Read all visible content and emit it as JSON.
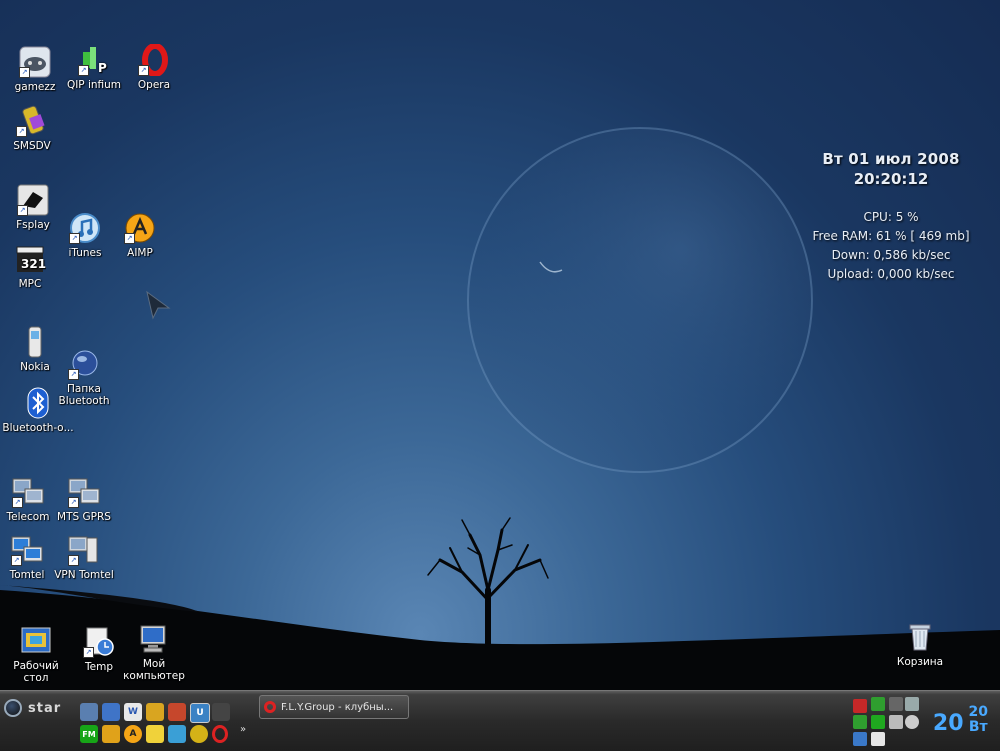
{
  "desktop": {
    "icons": [
      {
        "label": "gamezz",
        "icon": "gamepad-icon"
      },
      {
        "label": "QIP infium",
        "icon": "qip-flower-icon"
      },
      {
        "label": "Opera",
        "icon": "opera-icon"
      },
      {
        "label": "SMSDV",
        "icon": "phone-sms-icon"
      },
      {
        "label": "Fsplay",
        "icon": "fsplay-icon"
      },
      {
        "label": "iTunes",
        "icon": "itunes-icon"
      },
      {
        "label": "AIMP",
        "icon": "aimp-icon"
      },
      {
        "label": "MPC",
        "icon": "mpc-clapper-icon"
      },
      {
        "label": "Nokia",
        "icon": "nokia-phone-icon"
      },
      {
        "label": "Папка Bluetooth",
        "icon": "bluetooth-folder-globe-icon"
      },
      {
        "label": "Bluetooth-о...",
        "icon": "bluetooth-icon"
      },
      {
        "label": "Telecom",
        "icon": "network-connection-icon"
      },
      {
        "label": "MTS GPRS",
        "icon": "network-connection-icon"
      },
      {
        "label": "Tomtel",
        "icon": "network-connection-icon"
      },
      {
        "label": "VPN Tomtel",
        "icon": "vpn-connection-icon"
      },
      {
        "label": "Рабочий стол",
        "icon": "desktop-icon"
      },
      {
        "label": "Temp",
        "icon": "folder-clock-icon"
      },
      {
        "label": "Мой компьютер",
        "icon": "my-computer-icon"
      },
      {
        "label": "Корзина",
        "icon": "recycle-bin-icon"
      }
    ]
  },
  "sysinfo": {
    "date": "Вт 01 июл 2008",
    "time": "20:20:12",
    "cpu": "CPU: 5 %",
    "ram": "Free RAM: 61 % [ 469 mb]",
    "down": "Down: 0,586 kb/sec",
    "upload": "Upload: 0,000 kb/sec"
  },
  "taskbar": {
    "start_label": "star",
    "task_button": "F.L.Y.Group - клубны...",
    "overflow": "»",
    "clock": {
      "hour": "20",
      "minute": "20",
      "day": "Вт"
    },
    "colors": {
      "clock": "#49a9ff",
      "task_icon": "#d22222"
    }
  }
}
